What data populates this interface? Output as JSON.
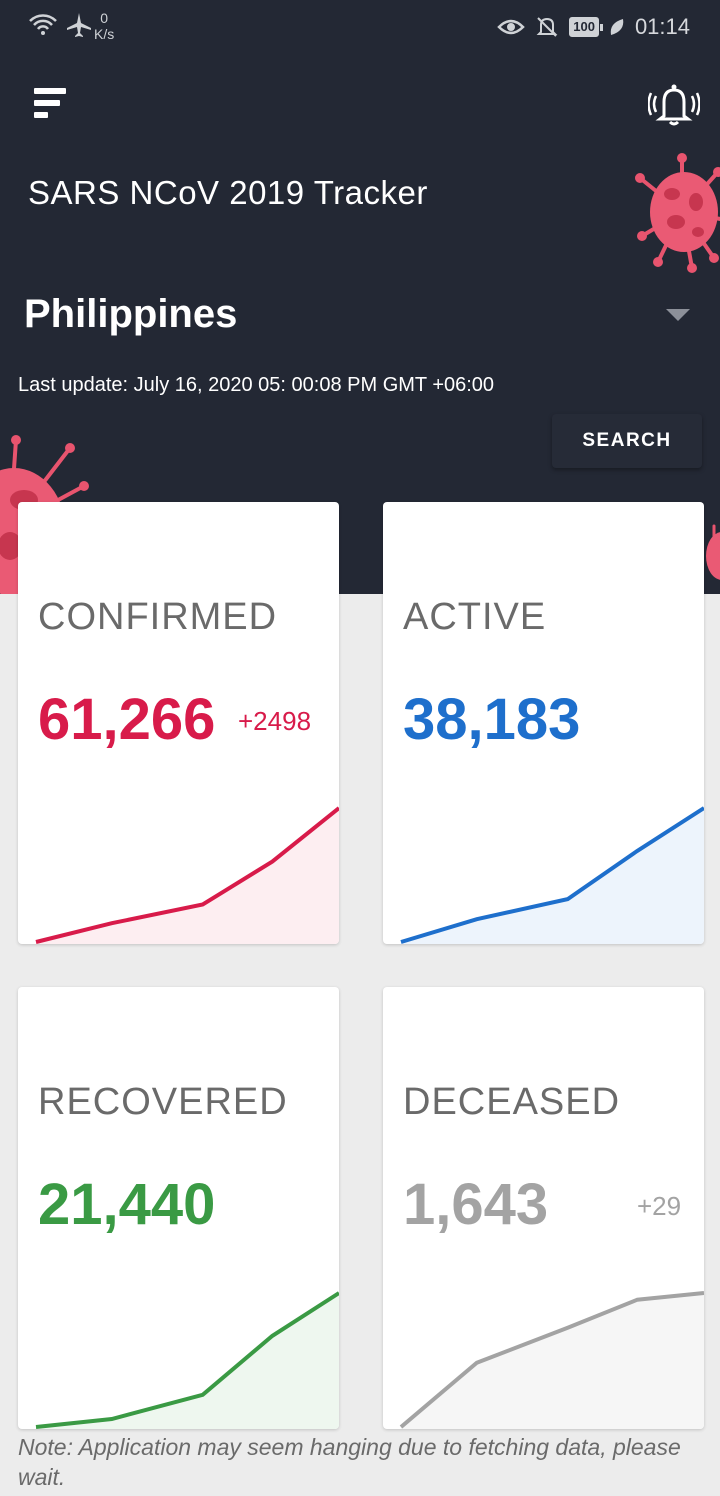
{
  "status_bar": {
    "speed_value": "0",
    "speed_unit": "K/s",
    "battery": "100",
    "time": "01:14",
    "icons": [
      "wifi-icon",
      "airplane-icon",
      "eye-icon",
      "bell-off-icon",
      "battery-icon",
      "leaf-icon"
    ]
  },
  "header": {
    "menu_icon": "menu-icon",
    "bell_icon": "bell-ringing-icon",
    "app_title": "SARS NCoV 2019 Tracker",
    "country": "Philippines",
    "last_update": "Last update: July 16, 2020 05: 00:08 PM GMT +06:00",
    "search_label": "SEARCH"
  },
  "cards": [
    {
      "label": "CONFIRMED",
      "value": "61,266",
      "delta": "+2498",
      "color": "#d81b4a",
      "fill": "#fdeef1",
      "trend": [
        0,
        14,
        28,
        60,
        100
      ]
    },
    {
      "label": "ACTIVE",
      "value": "38,183",
      "delta": "",
      "color": "#1e6fcc",
      "fill": "#edf4fc",
      "trend": [
        0,
        17,
        32,
        68,
        100
      ]
    },
    {
      "label": "RECOVERED",
      "value": "21,440",
      "delta": "",
      "color": "#3a9a44",
      "fill": "#eef7ef",
      "trend": [
        0,
        6,
        24,
        68,
        100
      ]
    },
    {
      "label": "DECEASED",
      "value": "1,643",
      "delta": "+29",
      "color": "#a3a3a3",
      "fill": "#f6f6f6",
      "trend": [
        0,
        48,
        74,
        95,
        100
      ]
    }
  ],
  "note": "Note: Application may seem hanging due to fetching data, please wait."
}
